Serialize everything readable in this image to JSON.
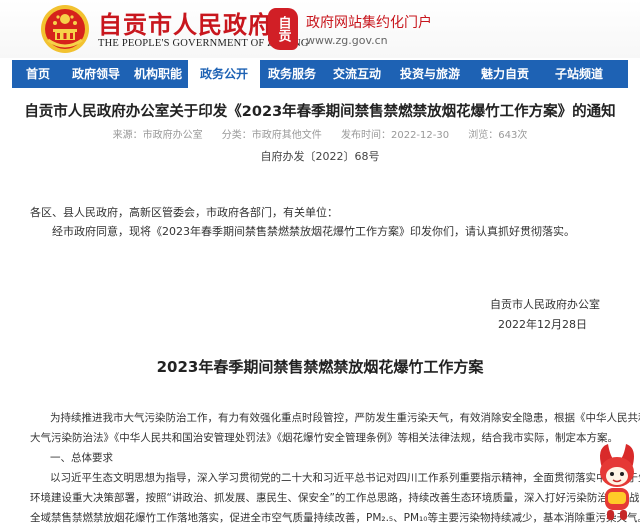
{
  "header": {
    "site_name_cn": "自贡市人民政府",
    "site_name_en": "THE PEOPLE'S GOVERNMENT OF ZIGONG",
    "seal_text": "自贡",
    "portal_title": "政府网站集约化门户",
    "portal_url": "www.zg.gov.cn"
  },
  "nav": {
    "items": [
      {
        "label": "首页"
      },
      {
        "label": "政府领导"
      },
      {
        "label": "机构职能"
      },
      {
        "label": "政务公开"
      },
      {
        "label": "政务服务"
      },
      {
        "label": "交流互动"
      },
      {
        "label": "投资与旅游"
      },
      {
        "label": "魅力自贡"
      },
      {
        "label": "子站频道"
      }
    ],
    "active_index": 3
  },
  "article": {
    "title": "自贡市人民政府办公室关于印发《2023年春季期间禁售禁燃禁放烟花爆竹工作方案》的通知",
    "meta": {
      "source": "来源：市政府办公室",
      "category": "分类：市政府其他文件",
      "date": "发布时间：2022-12-30",
      "views": "浏览：643次"
    },
    "doc_number": "自府办发〔2022〕68号",
    "salutation": "各区、县人民政府，高新区管委会，市政府各部门，有关单位：",
    "body_line": "经市政府同意，现将《2023年春季期间禁售禁燃禁放烟花爆竹工作方案》印发你们，请认真抓好贯彻落实。",
    "signer": "自贡市人民政府办公室",
    "sign_date": "2022年12月28日"
  },
  "plan": {
    "title": "2023年春季期间禁售禁燃禁放烟花爆竹工作方案",
    "intro_line1": "为持续推进我市大气污染防治工作，有力有效强化重点时段管控，严防发生重污染天气，有效消除安全隐患，根据《中华人民共和国",
    "intro_line2": "大气污染防治法》《中华人民共和国治安管理处罚法》《烟花爆竹安全管理条例》等相关法律法规，结合我市实际，制定本方案。",
    "section1": "一、总体要求",
    "req_line1": "以习近平生态文明思想为指导，深入学习贯彻党的二十大和习近平总书记对四川工作系列重要指示精神，全面贯彻落实中省关于生态",
    "req_line2": "环境建设重大决策部署，按照“讲政治、抓发展、惠民生、保安全”的工作总思路，持续改善生态环境质量，深入打好污染防治攻坚战，推动",
    "req_line3": "全域禁售禁燃禁放烟花爆竹工作落地落实，促进全市空气质量持续改善，PM₂.₅、PM₁₀等主要污染物持续减少，基本消除重污染天气。"
  },
  "colors": {
    "brand_red": "#c8161d",
    "nav_blue": "#1e62b4"
  }
}
